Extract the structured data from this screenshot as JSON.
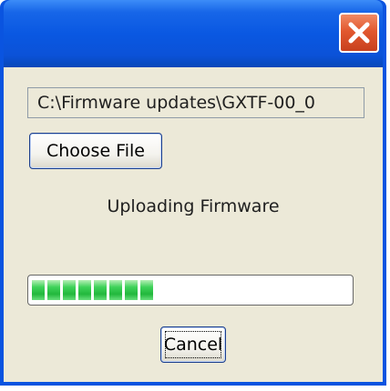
{
  "window": {
    "close_icon": "close-x-icon"
  },
  "file": {
    "path_value": "C:\\Firmware updates\\GXTF-00_0",
    "choose_label": "Choose File"
  },
  "status": {
    "label": "Uploading Firmware",
    "progress_fraction": 0.38
  },
  "actions": {
    "cancel_label": "Cancel"
  },
  "colors": {
    "titlebar": "#0a58e2",
    "close_button": "#e2582f",
    "dialog_face": "#ece9d8",
    "progress_fill": "#22b83c"
  }
}
